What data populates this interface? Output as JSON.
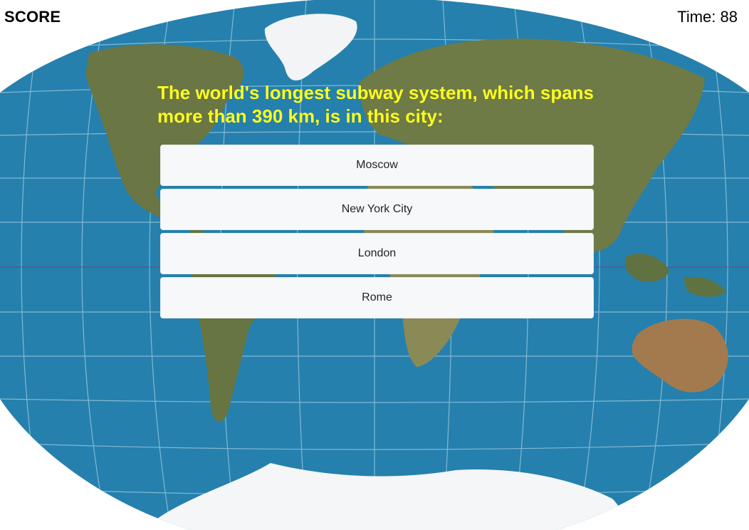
{
  "header": {
    "score_label": "SCORE",
    "timer_text": "Time: 88"
  },
  "quiz": {
    "question": "The world's longest subway system, which spans more than 390 km, is in this city:",
    "answers": [
      {
        "label": "Moscow"
      },
      {
        "label": "New York City"
      },
      {
        "label": "London"
      },
      {
        "label": "Rome"
      }
    ]
  },
  "colors": {
    "question_text": "#ffff1f",
    "ocean": "#2580ad",
    "land": "#6c7a45",
    "ice": "#f4f6f7",
    "button_bg": "#f7f8f9",
    "button_text": "#212529"
  },
  "background": {
    "image": "world-map"
  }
}
